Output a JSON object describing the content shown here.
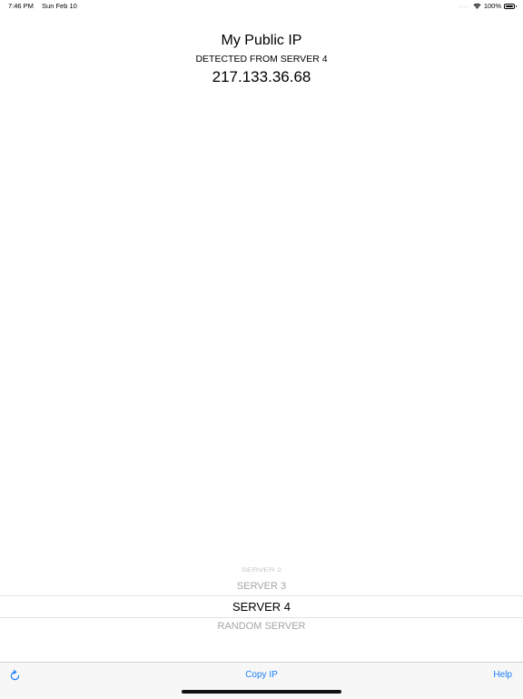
{
  "status_bar": {
    "time": "7:46 PM",
    "date": "Sun Feb 10",
    "signal": "....",
    "battery": "100%"
  },
  "header": {
    "title": "My Public IP",
    "subtitle": "DETECTED FROM SERVER 4",
    "ip": "217.133.36.68"
  },
  "picker": {
    "items": [
      "SERVER 2",
      "SERVER 3",
      "SERVER 4",
      "RANDOM SERVER"
    ],
    "selected": "SERVER 4"
  },
  "toolbar": {
    "copy_label": "Copy IP",
    "help_label": "Help",
    "refresh_icon": "refresh-icon"
  },
  "colors": {
    "accent": "#1a7ef5",
    "toolbar_bg": "#f7f7f7"
  }
}
